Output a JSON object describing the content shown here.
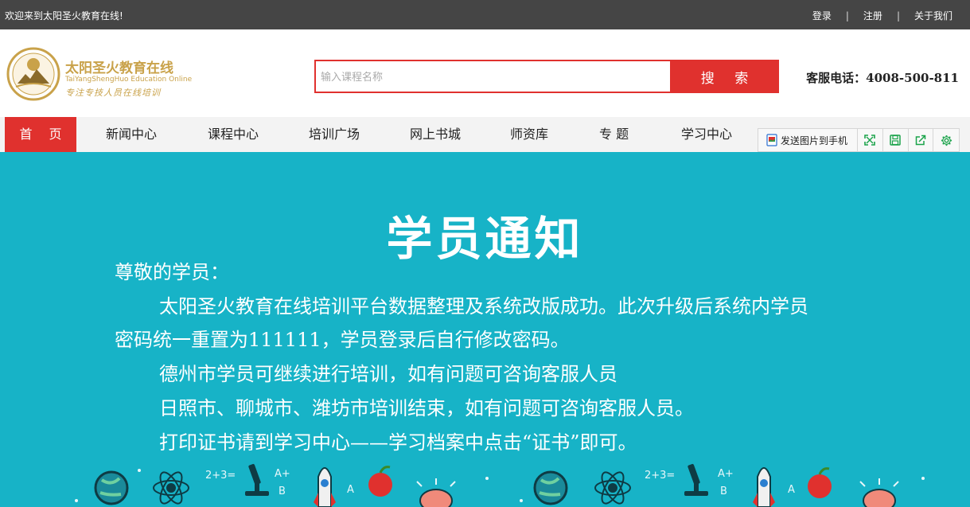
{
  "topbar": {
    "welcome": "欢迎来到太阳圣火教育在线!",
    "links": [
      "登录",
      "注册",
      "关于我们"
    ],
    "separator": "|"
  },
  "logo": {
    "name_cn": "太阳圣火教育在线",
    "name_en": "TaiYangShengHuo Education Online",
    "slogan": "专注专技人员在线培训"
  },
  "search": {
    "placeholder": "输入课程名称",
    "button": "搜 索"
  },
  "hotline": {
    "label": "客服电话：",
    "number": "4008-500-811"
  },
  "nav": {
    "home": "首 页",
    "items": [
      "新闻中心",
      "课程中心",
      "培训广场",
      "网上书城",
      "师资库",
      "专 题",
      "学习中心"
    ]
  },
  "toolbar": {
    "send_label": "发送图片到手机",
    "icons": [
      "fullscreen-icon",
      "save-icon",
      "share-icon",
      "settings-icon"
    ],
    "accent": "#1aa34a"
  },
  "notice": {
    "title": "学员通知",
    "greeting": "尊敬的学员：",
    "line1": "太阳圣火教育在线培训平台数据整理及系统改版成功。此次升级后系统内学员",
    "line2": "密码统一重置为111111，学员登录后自行修改密码。",
    "line3": "德州市学员可继续进行培训，如有问题可咨询客服人员",
    "line4": "日照市、聊城市、潍坊市培训结束，如有问题可咨询客服人员。",
    "line5": "打印证书请到学习中心——学习档案中点击“证书”即可。"
  },
  "colors": {
    "brand_red": "#e0312e",
    "banner_teal": "#17b3c7",
    "topbar_dark": "#454545",
    "logo_gold": "#c9a24a"
  }
}
